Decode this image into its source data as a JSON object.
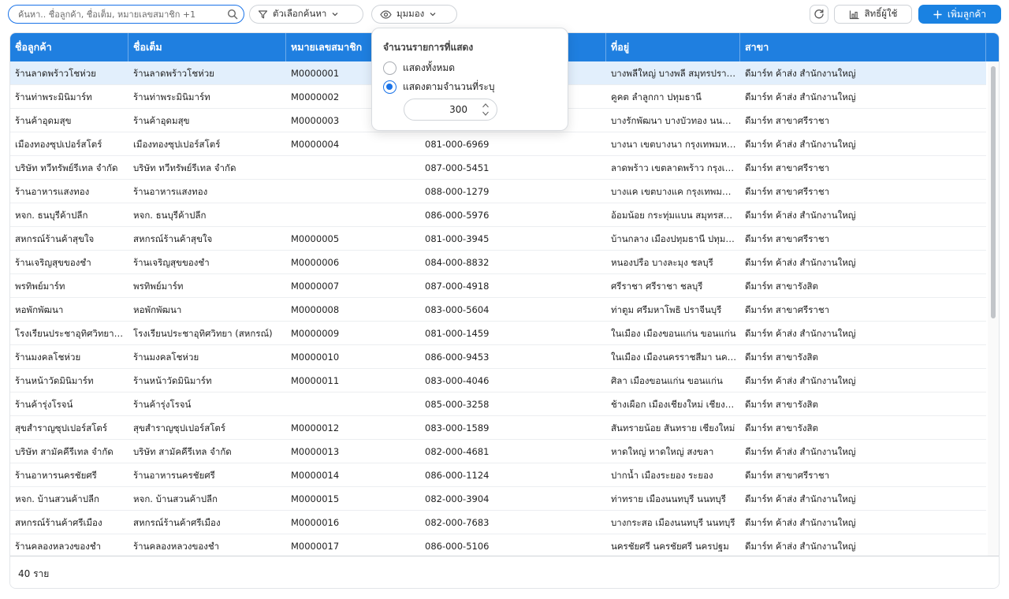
{
  "toolbar": {
    "search_placeholder": "ค้นหา.. ชื่อลูกค้า, ชื่อเต็ม, หมายเลขสมาชิก +1",
    "filter_label": "ตัวเลือกค้นหา",
    "view_label": "มุมมอง",
    "permissions_label": "สิทธิ์ผู้ใช้",
    "add_label": "เพิ่มลูกค้า",
    "accent": "#1a82e2"
  },
  "table": {
    "columns": [
      "ชื่อลูกค้า",
      "ชื่อเต็ม",
      "หมายเลขสมาชิก",
      "",
      "ที่อยู่",
      "สาขา"
    ],
    "rows": [
      [
        "ร้านลาดพร้าวโชห่วย",
        "ร้านลาดพร้าวโชห่วย",
        "M0000001",
        "",
        "บางพลีใหญ่ บางพลี สมุทรปราการ",
        "ดีมาร์ท ค้าส่ง สำนักงานใหญ่"
      ],
      [
        "ร้านท่าพระมินิมาร์ท",
        "ร้านท่าพระมินิมาร์ท",
        "M0000002",
        "",
        "คูคต ลำลูกกา ปทุมธานี",
        "ดีมาร์ท ค้าส่ง สำนักงานใหญ่"
      ],
      [
        "ร้านค้าอุดมสุข",
        "ร้านค้าอุดมสุข",
        "M0000003",
        "",
        "บางรักพัฒนา บางบัวทอง นนทบุรี",
        "ดีมาร์ท สาขาศรีราชา"
      ],
      [
        "เมืองทองซุปเปอร์สโตร์",
        "เมืองทองซุปเปอร์สโตร์",
        "M0000004",
        "081-000-6969",
        "บางนา เขตบางนา กรุงเทพมหานคร",
        "ดีมาร์ท ค้าส่ง สำนักงานใหญ่"
      ],
      [
        "บริษัท ทวีทรัพย์รีเทล จำกัด",
        "บริษัท ทวีทรัพย์รีเทล จำกัด",
        "",
        "087-000-5451",
        "ลาดพร้าว เขตลาดพร้าว กรุงเทพมหานคร",
        "ดีมาร์ท สาขาศรีราชา"
      ],
      [
        "ร้านอาหารแสงทอง",
        "ร้านอาหารแสงทอง",
        "",
        "088-000-1279",
        "บางแค เขตบางแค กรุงเทพมหานคร",
        "ดีมาร์ท สาขาศรีราชา"
      ],
      [
        "หจก. ธนบุรีค้าปลีก",
        "หจก. ธนบุรีค้าปลีก",
        "",
        "086-000-5976",
        "อ้อมน้อย กระทุ่มแบน สมุทรสาคร",
        "ดีมาร์ท ค้าส่ง สำนักงานใหญ่"
      ],
      [
        "สหกรณ์ร้านค้าสุขใจ",
        "สหกรณ์ร้านค้าสุขใจ",
        "M0000005",
        "081-000-3945",
        "บ้านกลาง เมืองปทุมธานี ปทุมธานี",
        "ดีมาร์ท สาขาศรีราชา"
      ],
      [
        "ร้านเจริญสุขของชำ",
        "ร้านเจริญสุขของชำ",
        "M0000006",
        "084-000-8832",
        "หนองปรือ บางละมุง ชลบุรี",
        "ดีมาร์ท ค้าส่ง สำนักงานใหญ่"
      ],
      [
        "พรทิพย์มาร์ท",
        "พรทิพย์มาร์ท",
        "M0000007",
        "087-000-4918",
        "ศรีราชา ศรีราชา ชลบุรี",
        "ดีมาร์ท สาขารังสิต"
      ],
      [
        "หอพักพัฒนา",
        "หอพักพัฒนา",
        "M0000008",
        "083-000-5604",
        "ท่าตูม ศรีมหาโพธิ ปราจีนบุรี",
        "ดีมาร์ท สาขาศรีราชา"
      ],
      [
        "โรงเรียนประชาอุทิศวิทยา (สหกรณ์)",
        "โรงเรียนประชาอุทิศวิทยา (สหกรณ์)",
        "M0000009",
        "081-000-1459",
        "ในเมือง เมืองขอนแก่น ขอนแก่น",
        "ดีมาร์ท ค้าส่ง สำนักงานใหญ่"
      ],
      [
        "ร้านมงคลโชห่วย",
        "ร้านมงคลโชห่วย",
        "M0000010",
        "086-000-9453",
        "ในเมือง เมืองนครราชสีมา นครราชสีมา",
        "ดีมาร์ท สาขารังสิต"
      ],
      [
        "ร้านหน้าวัดมินิมาร์ท",
        "ร้านหน้าวัดมินิมาร์ท",
        "M0000011",
        "083-000-4046",
        "ศิลา เมืองขอนแก่น ขอนแก่น",
        "ดีมาร์ท ค้าส่ง สำนักงานใหญ่"
      ],
      [
        "ร้านค้ารุ่งโรจน์",
        "ร้านค้ารุ่งโรจน์",
        "",
        "085-000-3258",
        "ช้างเผือก เมืองเชียงใหม่ เชียงใหม่",
        "ดีมาร์ท สาขารังสิต"
      ],
      [
        "สุขสำราญซุปเปอร์สโตร์",
        "สุขสำราญซุปเปอร์สโตร์",
        "M0000012",
        "083-000-1589",
        "สันทรายน้อย สันทราย เชียงใหม่",
        "ดีมาร์ท สาขารังสิต"
      ],
      [
        "บริษัท สามัคคีรีเทล จำกัด",
        "บริษัท สามัคคีรีเทล จำกัด",
        "M0000013",
        "082-000-4681",
        "หาดใหญ่ หาดใหญ่ สงขลา",
        "ดีมาร์ท ค้าส่ง สำนักงานใหญ่"
      ],
      [
        "ร้านอาหารนครชัยศรี",
        "ร้านอาหารนครชัยศรี",
        "M0000014",
        "086-000-1124",
        "ปากน้ำ เมืองระยอง ระยอง",
        "ดีมาร์ท สาขาศรีราชา"
      ],
      [
        "หจก. บ้านสวนค้าปลีก",
        "หจก. บ้านสวนค้าปลีก",
        "M0000015",
        "082-000-3904",
        "ท่าทราย เมืองนนทบุรี นนทบุรี",
        "ดีมาร์ท ค้าส่ง สำนักงานใหญ่"
      ],
      [
        "สหกรณ์ร้านค้าศรีเมือง",
        "สหกรณ์ร้านค้าศรีเมือง",
        "M0000016",
        "082-000-7683",
        "บางกระสอ เมืองนนทบุรี นนทบุรี",
        "ดีมาร์ท ค้าส่ง สำนักงานใหญ่"
      ],
      [
        "ร้านคลองหลวงของชำ",
        "ร้านคลองหลวงของชำ",
        "M0000017",
        "086-000-5106",
        "นครชัยศรี นครชัยศรี นครปฐม",
        "ดีมาร์ท ค้าส่ง สำนักงานใหญ่"
      ]
    ],
    "selected_row": 0,
    "header_color": "#1f7fe0",
    "selected_color": "#e2effc"
  },
  "footer": {
    "count": "40 ราย"
  },
  "popover": {
    "title": "จำนวนรายการที่แสดง",
    "options": [
      "แสดงทั้งหมด",
      "แสดงตามจำนวนที่ระบุ"
    ],
    "selected_option": 1,
    "count_value": "300"
  }
}
